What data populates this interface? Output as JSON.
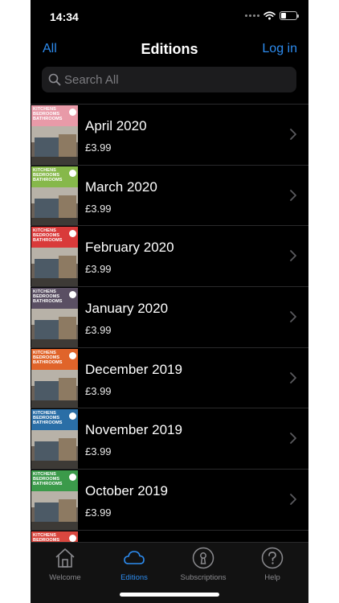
{
  "status_bar": {
    "time": "14:34"
  },
  "nav": {
    "left_label": "All",
    "title": "Editions",
    "right_label": "Log in"
  },
  "search": {
    "placeholder": "Search All"
  },
  "editions": [
    {
      "title": "April 2020",
      "price": "£3.99",
      "cover_color": "#e89aa8"
    },
    {
      "title": "March 2020",
      "price": "£3.99",
      "cover_color": "#86b84a"
    },
    {
      "title": "February 2020",
      "price": "£3.99",
      "cover_color": "#d93a3a"
    },
    {
      "title": "January 2020",
      "price": "£3.99",
      "cover_color": "#5a4f63"
    },
    {
      "title": "December 2019",
      "price": "£3.99",
      "cover_color": "#e0642a"
    },
    {
      "title": "November 2019",
      "price": "£3.99",
      "cover_color": "#2a6ea6"
    },
    {
      "title": "October 2019",
      "price": "£3.99",
      "cover_color": "#3b9a4a"
    },
    {
      "title": "",
      "price": "",
      "cover_color": "#d9473f"
    }
  ],
  "cover_masthead": "KITCHENS BEDROOMS BATHROOMS",
  "tabs": [
    {
      "label": "Welcome",
      "icon": "home-icon",
      "active": false
    },
    {
      "label": "Editions",
      "icon": "cloud-icon",
      "active": true
    },
    {
      "label": "Subscriptions",
      "icon": "lock-icon",
      "active": false
    },
    {
      "label": "Help",
      "icon": "help-icon",
      "active": false
    }
  ],
  "colors": {
    "accent": "#2d8cf0",
    "background": "#000000",
    "tab_inactive": "#8a8a8e"
  }
}
